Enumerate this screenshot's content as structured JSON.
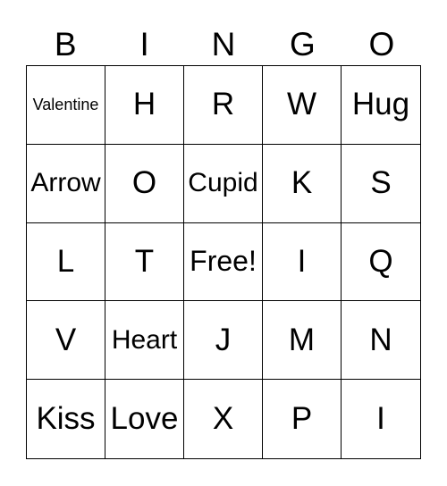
{
  "header": [
    "B",
    "I",
    "N",
    "G",
    "O"
  ],
  "cells": [
    [
      "Valentine",
      "H",
      "R",
      "W",
      "Hug"
    ],
    [
      "Arrow",
      "O",
      "Cupid",
      "K",
      "S"
    ],
    [
      "L",
      "T",
      "Free!",
      "I",
      "Q"
    ],
    [
      "V",
      "Heart",
      "J",
      "M",
      "N"
    ],
    [
      "Kiss",
      "Love",
      "X",
      "P",
      "I"
    ]
  ]
}
